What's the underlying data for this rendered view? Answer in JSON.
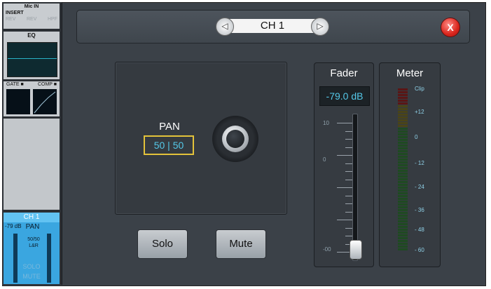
{
  "strip": {
    "mic_in": "Mic IN",
    "insert": "INSERT",
    "rev1": "REV",
    "rev2": "REV",
    "hpf": "HPF",
    "eq_label": "EQ",
    "gate_label": "GATE ■",
    "comp_label": "COMP ■",
    "channel": "CH 1",
    "level": "-79 dB",
    "pan_label": "PAN",
    "pan_value": "50/50",
    "route": "L&R",
    "solo": "SOLO",
    "mute": "MUTE"
  },
  "header": {
    "channel": "CH 1",
    "prev_icon": "◁",
    "next_icon": "▷",
    "close_icon": "X"
  },
  "pan": {
    "label": "PAN",
    "value": "50 | 50"
  },
  "buttons": {
    "solo": "Solo",
    "mute": "Mute"
  },
  "fader": {
    "title": "Fader",
    "readout": "-79.0 dB",
    "scale": [
      "10",
      "0",
      "-00"
    ],
    "position": 0.02
  },
  "meter": {
    "title": "Meter",
    "scale": [
      "Clip",
      "+12",
      "0",
      "- 12",
      "- 24",
      "- 36",
      "- 48",
      "- 60"
    ]
  },
  "colors": {
    "accent": "#54c8e8",
    "strip_active": "#3aa6e0",
    "close": "#d9251c",
    "pan_border": "#e3c23a"
  }
}
